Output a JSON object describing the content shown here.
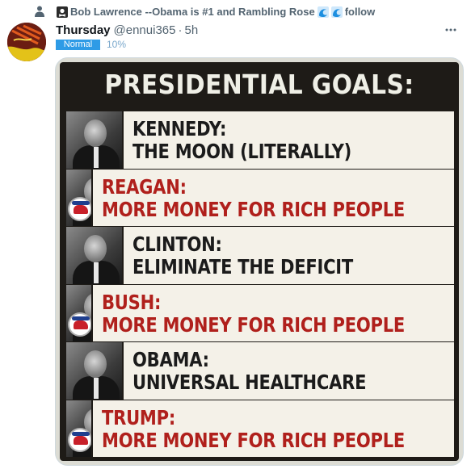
{
  "social_context": {
    "text": "Bob Lawrence --Obama is #1 and Rambling Rose",
    "follow_label": "follow"
  },
  "tweet": {
    "display_name": "Thursday",
    "handle": "@ennui365",
    "separator": "·",
    "time": "5h",
    "badge": "Normal",
    "percent": "10%"
  },
  "poster": {
    "title": "PRESIDENTIAL GOALS:",
    "rows": [
      {
        "name": "KENNEDY:",
        "goal": "THE MOON (LITERALLY)",
        "color": "dark",
        "party_logo": false
      },
      {
        "name": "REAGAN:",
        "goal": "MORE MONEY FOR RICH PEOPLE",
        "color": "red",
        "party_logo": true
      },
      {
        "name": "CLINTON:",
        "goal": "ELIMINATE THE DEFICIT",
        "color": "dark",
        "party_logo": false
      },
      {
        "name": "BUSH:",
        "goal": "MORE MONEY FOR RICH PEOPLE",
        "color": "red",
        "party_logo": true
      },
      {
        "name": "OBAMA:",
        "goal": "UNIVERSAL HEALTHCARE",
        "color": "dark",
        "party_logo": false
      },
      {
        "name": "TRUMP:",
        "goal": "MORE MONEY FOR RICH PEOPLE",
        "color": "red",
        "party_logo": true
      }
    ]
  },
  "colors": {
    "accent_blue": "#2e9be6",
    "red_text": "#b0201c",
    "dark_text": "#1b1b1b",
    "poster_background": "#1e1b17",
    "row_background": "#f4f1e8"
  },
  "icons": [
    "person-icon",
    "pirate-flag-icon",
    "wave-icon",
    "more-options-icon",
    "avatar",
    "republican-elephant-logo"
  ]
}
